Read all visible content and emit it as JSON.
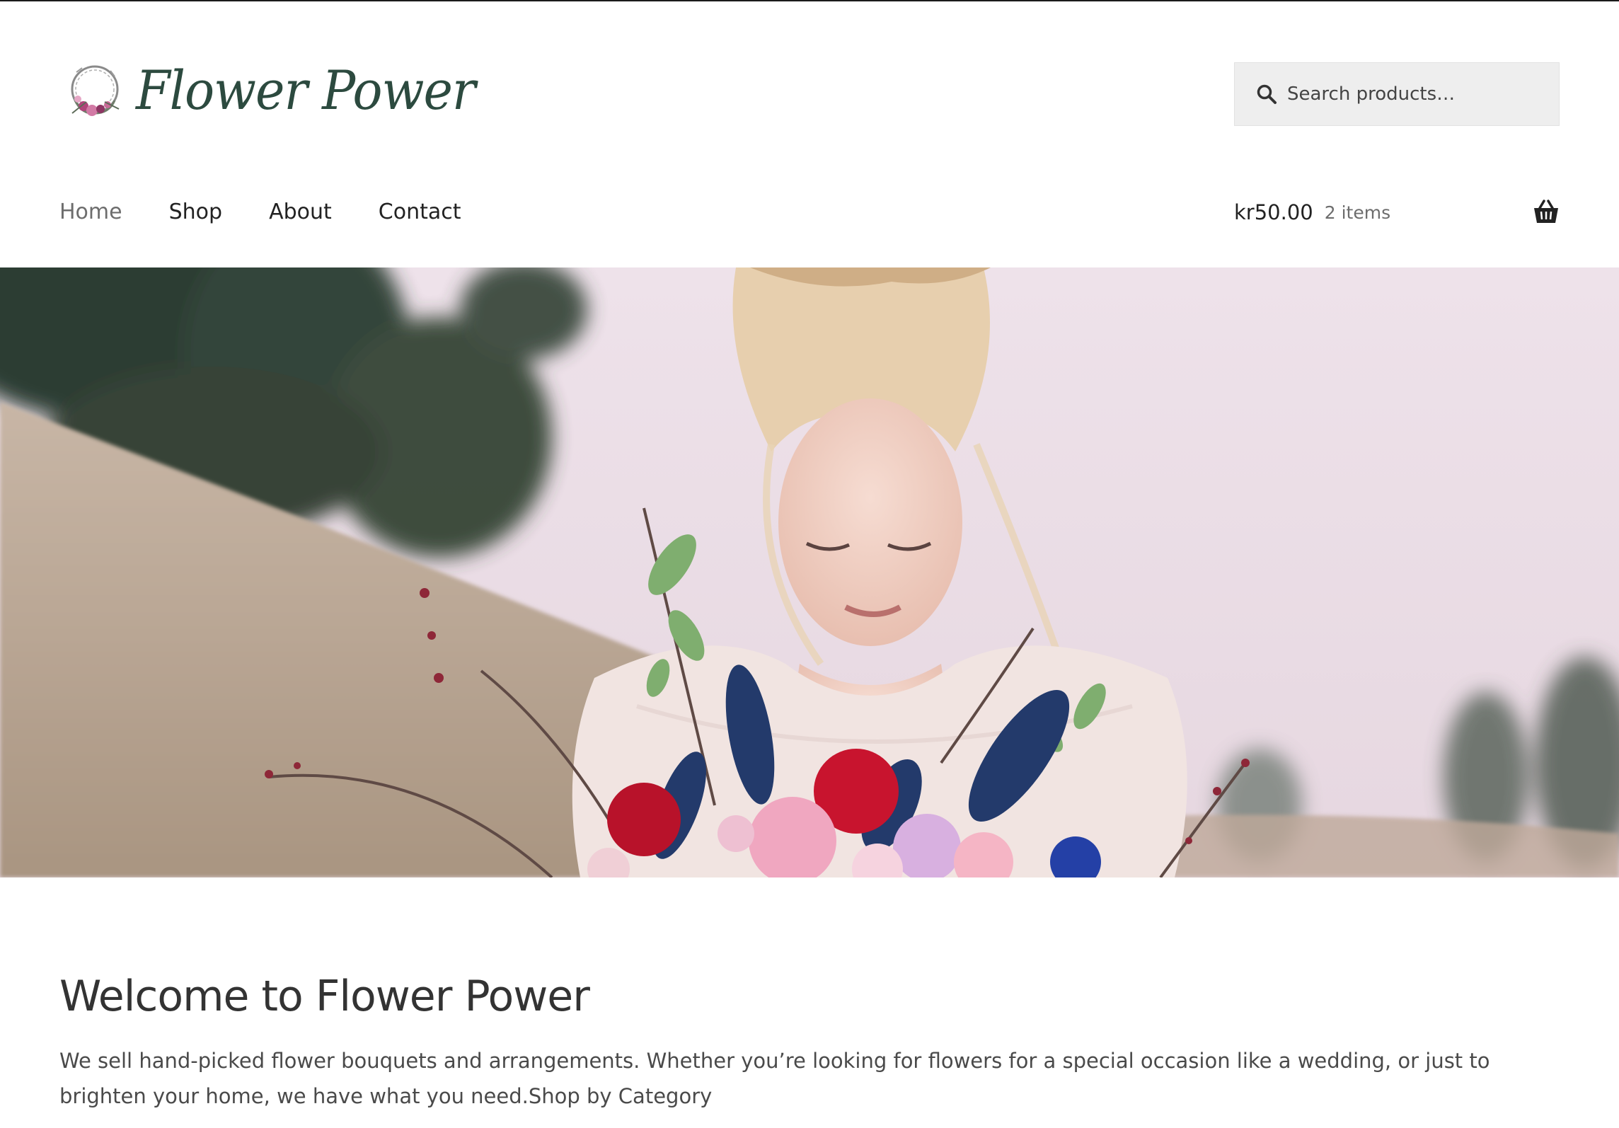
{
  "site": {
    "logo_text": "Flower Power"
  },
  "search": {
    "placeholder": "Search products…"
  },
  "nav": {
    "items": [
      {
        "label": "Home",
        "current": true
      },
      {
        "label": "Shop",
        "current": false
      },
      {
        "label": "About",
        "current": false
      },
      {
        "label": "Contact",
        "current": false
      }
    ]
  },
  "cart": {
    "amount": "kr50.00",
    "count": "2 items"
  },
  "main": {
    "title": "Welcome to Flower Power",
    "intro": "We sell hand-picked flower bouquets and arrangements. Whether you’re looking for flowers for a special occasion like a wedding, or just to brighten your home, we have what you need.Shop by Category"
  },
  "icons": {
    "search": "search-icon",
    "cart": "basket-icon",
    "logo": "wreath-logo-icon"
  },
  "colors": {
    "brand_text": "#2c4a3f",
    "nav_current": "#6d6d6d",
    "search_bg": "#eeeeee"
  }
}
